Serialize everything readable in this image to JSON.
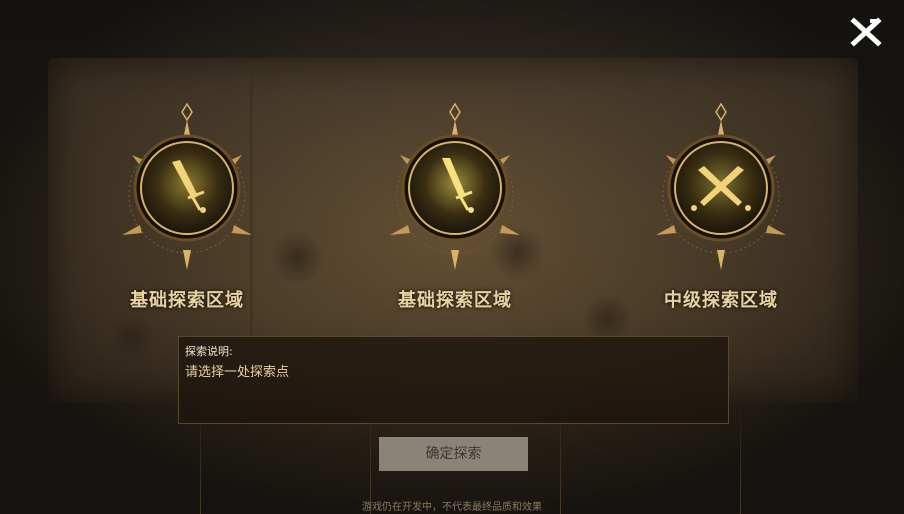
{
  "areas": [
    {
      "label": "基础探索区域",
      "icon": "single-sword-icon"
    },
    {
      "label": "基础探索区域",
      "icon": "single-sword-icon"
    },
    {
      "label": "中级探索区域",
      "icon": "crossed-swords-icon"
    }
  ],
  "description": {
    "title": "探索说明:",
    "text": "请选择一处探索点"
  },
  "confirm_label": "确定探索",
  "disclaimer": "游戏仍在开发中，不代表最终品质和效果",
  "colors": {
    "gold": "#d9b26a",
    "label": "#e9d2a2",
    "button_bg": "#8a8478"
  }
}
